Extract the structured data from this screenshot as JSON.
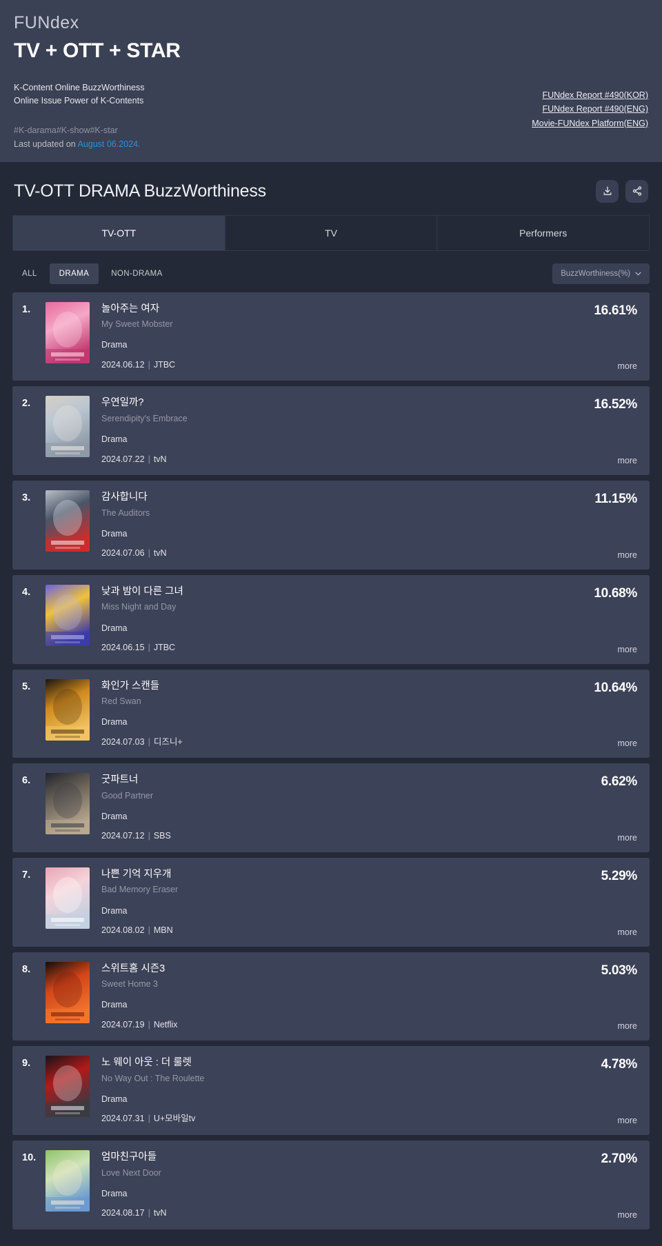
{
  "header": {
    "brand": "FUNdex",
    "headline": "TV + OTT + STAR",
    "subtitle_line1": "K-Content Online BuzzWorthiness",
    "subtitle_line2": "Online Issue Power of K-Contents",
    "hashtags": "#K-darama#K-show#K-star",
    "updated_prefix": "Last updated on ",
    "updated_date": "August 06.2024.",
    "links": [
      "FUNdex Report #490(KOR)",
      "FUNdex Report #490(ENG)",
      "Movie-FUNdex Platform(ENG)"
    ]
  },
  "content": {
    "page_title": "TV-OTT DRAMA BuzzWorthiness",
    "download_icon": "download-icon",
    "share_icon": "share-icon",
    "tabs": [
      {
        "label": "TV-OTT",
        "active": true
      },
      {
        "label": "TV",
        "active": false
      },
      {
        "label": "Performers",
        "active": false
      }
    ],
    "filters": [
      {
        "label": "ALL",
        "active": false
      },
      {
        "label": "DRAMA",
        "active": true
      },
      {
        "label": "NON-DRAMA",
        "active": false
      }
    ],
    "sort": {
      "value": "BuzzWorthiness(%)",
      "chevron_icon": "chevron-down-icon"
    },
    "more_label": "more"
  },
  "chart_data": {
    "type": "bar",
    "title": "TV-OTT DRAMA BuzzWorthiness",
    "xlabel": "",
    "ylabel": "BuzzWorthiness(%)",
    "ylim": [
      0,
      20
    ],
    "categories": [
      "My Sweet Mobster",
      "Serendipity's Embrace",
      "The Auditors",
      "Miss Night and Day",
      "Red Swan",
      "Good Partner",
      "Bad Memory Eraser",
      "Sweet Home 3",
      "No Way Out : The Roulette",
      "Love Next Door"
    ],
    "values": [
      16.61,
      16.52,
      11.15,
      10.68,
      10.64,
      6.62,
      5.29,
      5.03,
      4.78,
      2.7
    ]
  },
  "list": [
    {
      "rank": "1.",
      "title_ko": "놀아주는 여자",
      "title_en": "My Sweet Mobster",
      "genre": "Drama",
      "date": "2024.06.12",
      "channel": "JTBC",
      "pct": "16.61%",
      "poster_colors": [
        "#e86a9d",
        "#f4a8c6",
        "#c0386f",
        "#ffd8e6"
      ]
    },
    {
      "rank": "2.",
      "title_ko": "우연일까?",
      "title_en": "Serendipity's Embrace",
      "genre": "Drama",
      "date": "2024.07.22",
      "channel": "tvN",
      "pct": "16.52%",
      "poster_colors": [
        "#d7cfc6",
        "#b9c6d2",
        "#8e9aa8",
        "#efe7dd"
      ]
    },
    {
      "rank": "3.",
      "title_ko": "감사합니다",
      "title_en": "The Auditors",
      "genre": "Drama",
      "date": "2024.07.06",
      "channel": "tvN",
      "pct": "11.15%",
      "poster_colors": [
        "#b9bfc6",
        "#4a5668",
        "#cf2b2b",
        "#e8eaec"
      ]
    },
    {
      "rank": "4.",
      "title_ko": "낮과 밤이 다른 그녀",
      "title_en": "Miss Night and Day",
      "genre": "Drama",
      "date": "2024.06.15",
      "channel": "JTBC",
      "pct": "10.68%",
      "poster_colors": [
        "#6a63e0",
        "#f0c23a",
        "#3d3aa8",
        "#b8b4f2"
      ]
    },
    {
      "rank": "5.",
      "title_ko": "화인가 스캔들",
      "title_en": "Red Swan",
      "genre": "Drama",
      "date": "2024.07.03",
      "channel": "디즈니+",
      "pct": "10.64%",
      "poster_colors": [
        "#1a1410",
        "#d08a1e",
        "#f0c462",
        "#5a3a14"
      ]
    },
    {
      "rank": "6.",
      "title_ko": "굿파트너",
      "title_en": "Good Partner",
      "genre": "Drama",
      "date": "2024.07.12",
      "channel": "SBS",
      "pct": "6.62%",
      "poster_colors": [
        "#20242c",
        "#6b6258",
        "#b8a890",
        "#3a3f48"
      ]
    },
    {
      "rank": "7.",
      "title_ko": "나쁜 기억 지우개",
      "title_en": "Bad Memory Eraser",
      "genre": "Drama",
      "date": "2024.08.02",
      "channel": "MBN",
      "pct": "5.29%",
      "poster_colors": [
        "#e8a5b4",
        "#f5d3da",
        "#c3d0e0",
        "#ffffff"
      ]
    },
    {
      "rank": "8.",
      "title_ko": "스위트홈 시즌3",
      "title_en": "Sweet Home 3",
      "genre": "Drama",
      "date": "2024.07.19",
      "channel": "Netflix",
      "pct": "5.03%",
      "poster_colors": [
        "#120c0a",
        "#d2451a",
        "#f0762c",
        "#7a1e10"
      ]
    },
    {
      "rank": "9.",
      "title_ko": "노 웨이 아웃 : 더 룰렛",
      "title_en": "No Way Out : The Roulette",
      "genre": "Drama",
      "date": "2024.07.31",
      "channel": "U+모바일tv",
      "pct": "4.78%",
      "poster_colors": [
        "#151519",
        "#b01a1a",
        "#3a3a42",
        "#e0e0e4"
      ]
    },
    {
      "rank": "10.",
      "title_ko": "엄마친구아들",
      "title_en": "Love Next Door",
      "genre": "Drama",
      "date": "2024.08.17",
      "channel": "tvN",
      "pct": "2.70%",
      "poster_colors": [
        "#8fc46a",
        "#cfe3b8",
        "#6a9ad0",
        "#f2e8d0"
      ]
    }
  ]
}
